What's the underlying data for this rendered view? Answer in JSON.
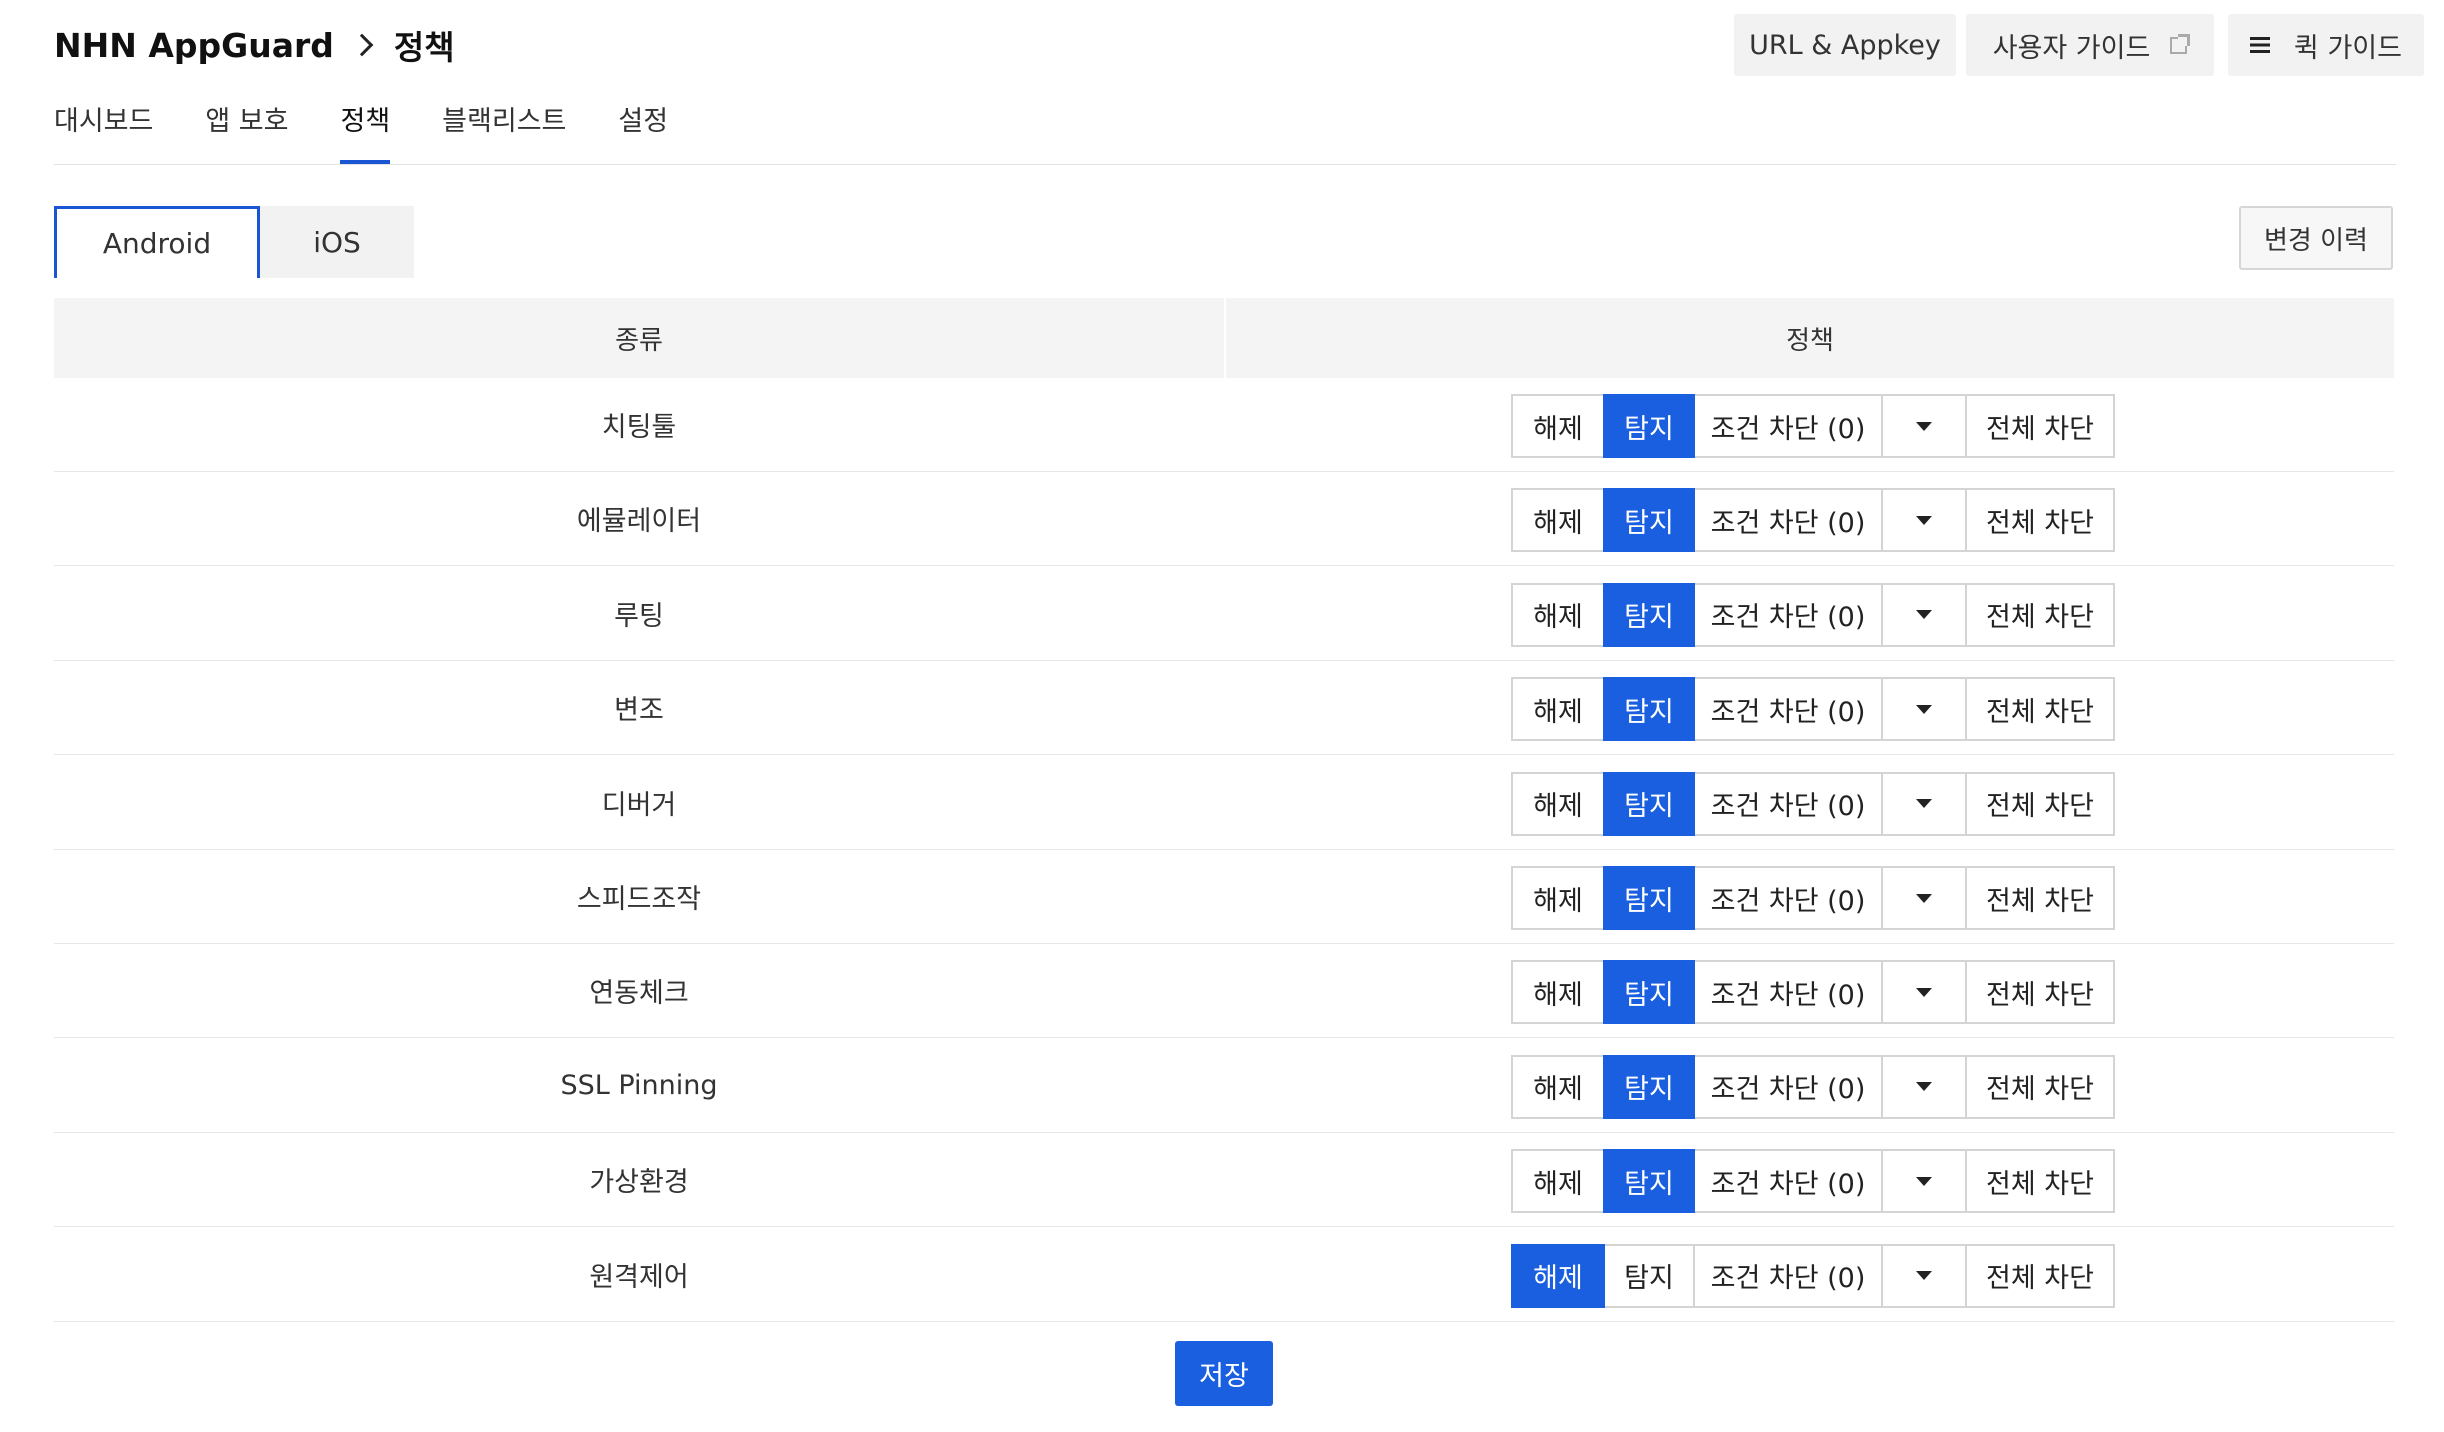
{
  "header": {
    "product": "NHN AppGuard",
    "current_page": "정책",
    "url_appkey": "URL & Appkey",
    "user_guide": "사용자 가이드",
    "quick_guide": "퀵 가이드"
  },
  "nav": {
    "items": [
      {
        "label": "대시보드"
      },
      {
        "label": "앱 보호"
      },
      {
        "label": "정책"
      },
      {
        "label": "블랙리스트"
      },
      {
        "label": "설정"
      }
    ],
    "active": "정책"
  },
  "platform_tabs": [
    {
      "label": "Android"
    },
    {
      "label": "iOS"
    }
  ],
  "active_platform": "Android",
  "history_button": "변경 이력",
  "table": {
    "headers": {
      "kind": "종류",
      "policy": "정책"
    },
    "option_labels": {
      "release": "해제",
      "detect": "탐지",
      "conditional_block": "조건 차단 (0)",
      "block_all": "전체 차단"
    },
    "rows": [
      {
        "kind": "치팅툴",
        "selected": "탐지"
      },
      {
        "kind": "에뮬레이터",
        "selected": "탐지"
      },
      {
        "kind": "루팅",
        "selected": "탐지"
      },
      {
        "kind": "변조",
        "selected": "탐지"
      },
      {
        "kind": "디버거",
        "selected": "탐지"
      },
      {
        "kind": "스피드조작",
        "selected": "탐지"
      },
      {
        "kind": "연동체크",
        "selected": "탐지"
      },
      {
        "kind": "SSL Pinning",
        "selected": "탐지"
      },
      {
        "kind": "가상환경",
        "selected": "탐지"
      },
      {
        "kind": "원격제어",
        "selected": "해제"
      }
    ]
  },
  "save_button": "저장",
  "colors": {
    "accent": "#1a5fe0",
    "header_bg": "#f4f4f4",
    "button_bg": "#f2f2f2"
  },
  "icons": {
    "breadcrumb_separator": "chevron-right-icon",
    "external_link": "external-link-icon",
    "menu": "menu-icon",
    "dropdown": "caret-down-icon"
  }
}
